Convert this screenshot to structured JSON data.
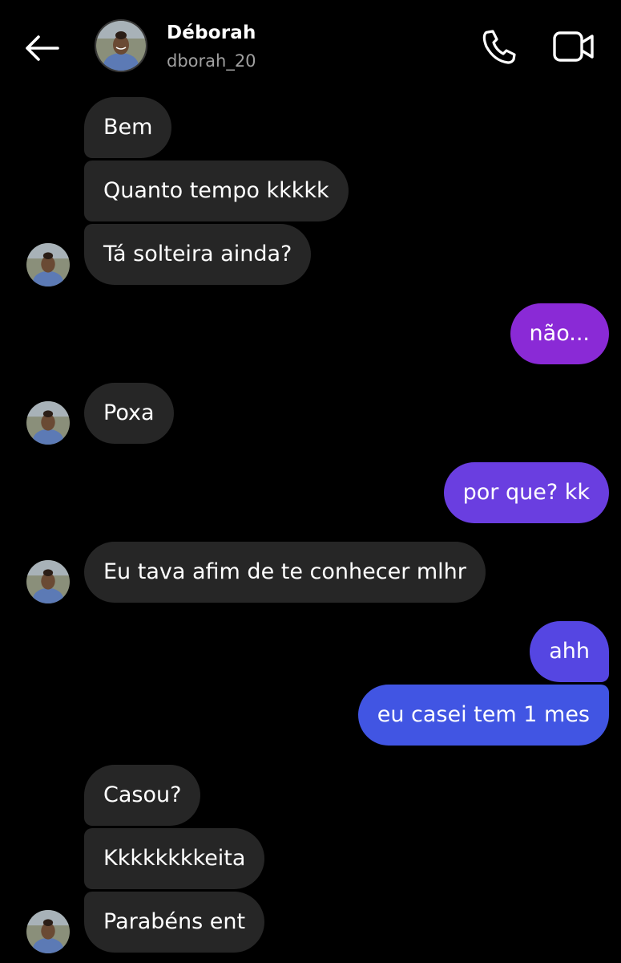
{
  "header": {
    "contact_name": "Déborah",
    "username": "dborah_20",
    "icons": {
      "back": "back-arrow-icon",
      "call": "phone-call-icon",
      "video": "video-call-icon"
    }
  },
  "messages": [
    {
      "from": "contact",
      "text": "Bem"
    },
    {
      "from": "contact",
      "text": "Quanto tempo kkkkk"
    },
    {
      "from": "contact",
      "text": "Tá solteira ainda?"
    },
    {
      "from": "me",
      "text": "não..."
    },
    {
      "from": "contact",
      "text": "Poxa"
    },
    {
      "from": "me",
      "text": "por que? kk"
    },
    {
      "from": "contact",
      "text": "Eu tava afim de te conhecer mlhr"
    },
    {
      "from": "me",
      "text": "ahh"
    },
    {
      "from": "me",
      "text": "eu casei tem 1 mes"
    },
    {
      "from": "contact",
      "text": "Casou?"
    },
    {
      "from": "contact",
      "text": "Kkkkkkkkeita"
    },
    {
      "from": "contact",
      "text": "Parabéns ent"
    }
  ],
  "colors": {
    "background": "#000000",
    "incoming_bubble": "#262626",
    "outgoing_gradient_top": "#8a2ad6",
    "outgoing_gradient_bottom": "#4155e3"
  }
}
